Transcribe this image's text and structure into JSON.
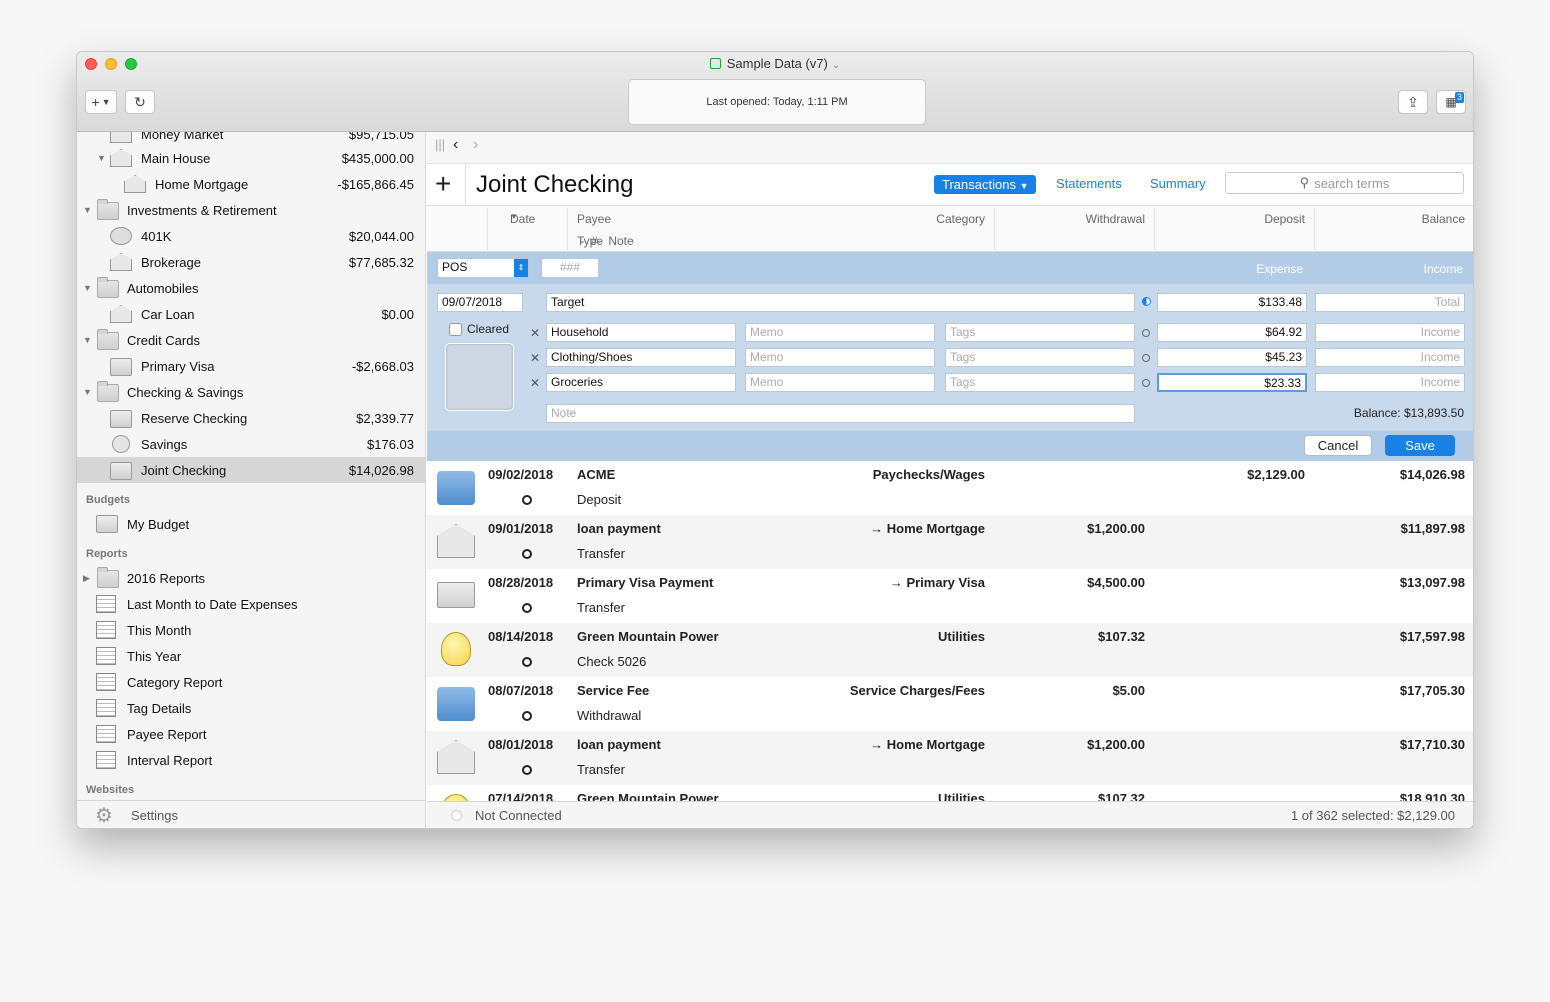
{
  "window": {
    "title": "Sample Data (v7)",
    "status": "Last opened: Today, 1:11 PM",
    "badge": "3"
  },
  "sidebar": {
    "clipped_top": {
      "name": "Money Market",
      "value": "$95,715.05"
    },
    "rows": [
      {
        "name": "Main House",
        "value": "$435,000.00"
      },
      {
        "name": "Home Mortgage",
        "value": "-$165,866.45"
      },
      {
        "name": "Investments & Retirement",
        "value": ""
      },
      {
        "name": "401K",
        "value": "$20,044.00"
      },
      {
        "name": "Brokerage",
        "value": "$77,685.32"
      },
      {
        "name": "Automobiles",
        "value": ""
      },
      {
        "name": "Car Loan",
        "value": "$0.00"
      },
      {
        "name": "Credit Cards",
        "value": ""
      },
      {
        "name": "Primary Visa",
        "value": "-$2,668.03"
      },
      {
        "name": "Checking & Savings",
        "value": ""
      },
      {
        "name": "Reserve Checking",
        "value": "$2,339.77"
      },
      {
        "name": "Savings",
        "value": "$176.03"
      },
      {
        "name": "Joint Checking",
        "value": "$14,026.98"
      }
    ],
    "budgets_heading": "Budgets",
    "budgets": [
      {
        "name": "My Budget"
      }
    ],
    "reports_heading": "Reports",
    "reports": [
      {
        "name": "2016 Reports"
      },
      {
        "name": "Last Month to Date Expenses"
      },
      {
        "name": "This Month"
      },
      {
        "name": "This Year"
      },
      {
        "name": "Category Report"
      },
      {
        "name": "Tag Details"
      },
      {
        "name": "Payee Report"
      },
      {
        "name": "Interval Report"
      }
    ],
    "websites_heading": "Websites",
    "settings_label": "Settings"
  },
  "header": {
    "title": "Joint Checking",
    "tabs": {
      "transactions": "Transactions",
      "statements": "Statements",
      "summary": "Summary"
    },
    "search_placeholder": "search terms"
  },
  "columns": {
    "date": "Date",
    "payee": "Payee",
    "category": "Category",
    "withdrawal": "Withdrawal",
    "deposit": "Deposit",
    "balance": "Balance",
    "sub_type": "Type",
    "sub_num": "#",
    "sub_note": "Note"
  },
  "editor": {
    "type": "POS",
    "number_placeholder": "###",
    "expense_label": "Expense",
    "income_label": "Income",
    "date": "09/07/2018",
    "payee": "Target",
    "expense_total": "$133.48",
    "total_placeholder": "Total",
    "cleared_label": "Cleared",
    "memo_placeholder": "Memo",
    "tags_placeholder": "Tags",
    "income_placeholder": "Income",
    "note_placeholder": "Note",
    "splits": [
      {
        "category": "Household",
        "amount": "$64.92"
      },
      {
        "category": "Clothing/Shoes",
        "amount": "$45.23"
      },
      {
        "category": "Groceries",
        "amount": "$23.33"
      }
    ],
    "balance_label": "Balance:",
    "balance_value": "$13,893.50",
    "cancel_label": "Cancel",
    "save_label": "Save"
  },
  "transactions": [
    {
      "date": "09/02/2018",
      "payee": "ACME",
      "category": "Paychecks/Wages",
      "type": "Deposit",
      "withdrawal": "",
      "deposit": "$2,129.00",
      "balance": "$14,026.98",
      "icon": "bank-folder-icon"
    },
    {
      "date": "09/01/2018",
      "payee": "loan payment",
      "category": "→ Home Mortgage",
      "type": "Transfer",
      "withdrawal": "$1,200.00",
      "deposit": "",
      "balance": "$11,897.98",
      "icon": "bank-icon"
    },
    {
      "date": "08/28/2018",
      "payee": "Primary Visa Payment",
      "category": "→ Primary Visa",
      "type": "Transfer",
      "withdrawal": "$4,500.00",
      "deposit": "",
      "balance": "$13,097.98",
      "icon": "credit-card-icon"
    },
    {
      "date": "08/14/2018",
      "payee": "Green Mountain Power",
      "category": "Utilities",
      "type": "Check 5026",
      "withdrawal": "$107.32",
      "deposit": "",
      "balance": "$17,597.98",
      "icon": "lightbulb-icon"
    },
    {
      "date": "08/07/2018",
      "payee": "Service Fee",
      "category": "Service Charges/Fees",
      "type": "Withdrawal",
      "withdrawal": "$5.00",
      "deposit": "",
      "balance": "$17,705.30",
      "icon": "bank-folder-icon"
    },
    {
      "date": "08/01/2018",
      "payee": "loan payment",
      "category": "→ Home Mortgage",
      "type": "Transfer",
      "withdrawal": "$1,200.00",
      "deposit": "",
      "balance": "$17,710.30",
      "icon": "bank-icon"
    },
    {
      "date": "07/14/2018",
      "payee": "Green Mountain Power",
      "category": "Utilities",
      "type": "",
      "withdrawal": "$107.32",
      "deposit": "",
      "balance": "$18,910.30",
      "icon": "lightbulb-icon"
    }
  ],
  "statusbar": {
    "connection": "Not Connected",
    "selection": "1 of 362 selected: $2,129.00"
  },
  "colors": {
    "accent": "#1781e6",
    "editor_bg": "#c8d9ec",
    "editor_bar": "#b2cbe6"
  }
}
